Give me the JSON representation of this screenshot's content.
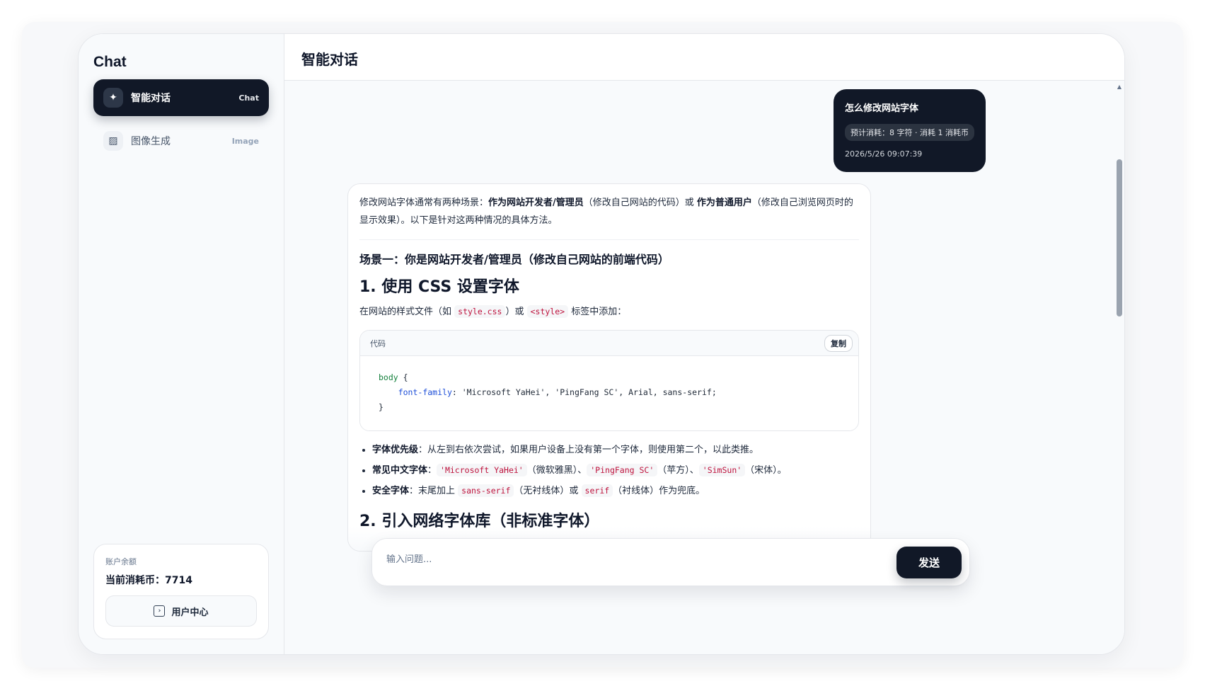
{
  "sidebar": {
    "title": "Chat",
    "items": [
      {
        "icon": "sparkle-icon",
        "label": "智能对话",
        "tag": "Chat"
      },
      {
        "icon": "image-icon",
        "label": "图像生成",
        "tag": "Image"
      }
    ],
    "balance": {
      "label": "账户余额",
      "value_text": "当前消耗币：7714",
      "user_center_label": "用户中心"
    }
  },
  "header": {
    "title": "智能对话"
  },
  "conversation": {
    "user_message": {
      "text": "怎么修改网站字体",
      "cost": "预计消耗：8 字符 · 消耗 1 消耗币",
      "time": "2026/5/26 09:07:39"
    },
    "assistant": {
      "intro_a": "修改网站字体通常有两种场景：",
      "intro_b1": "作为网站开发者/管理员",
      "intro_c": "（修改自己网站的代码）或 ",
      "intro_b2": "作为普通用户",
      "intro_d": "（修改自己浏览网页时的显示效果）。以下是针对这两种情况的具体方法。",
      "scene1_title": "场景一：你是网站开发者/管理员（修改自己网站的前端代码）",
      "h1": "1. 使用 CSS 设置字体",
      "para_a": "在网站的样式文件（如 ",
      "code1": "style.css",
      "para_b": "）或 ",
      "code2": "<style>",
      "para_c": " 标签中添加：",
      "code_label": "代码",
      "copy_label": "复制",
      "code_line1_sel": "body",
      "code_line1_rest": " {",
      "code_line2_prop": "font-family",
      "code_line2_rest": ": 'Microsoft YaHei', 'PingFang SC', Arial, sans-serif;",
      "code_line3": "}",
      "bullets": {
        "b1_key": "字体优先级",
        "b1_text": "：从左到右依次尝试，如果用户设备上没有第一个字体，则使用第二个，以此类推。",
        "b2_key": "常见中文字体",
        "b2_sep": "：",
        "b2_c1": "'Microsoft YaHei'",
        "b2_t1": "（微软雅黑）、",
        "b2_c2": "'PingFang SC'",
        "b2_t2": "（苹方）、",
        "b2_c3": "'SimSun'",
        "b2_t3": "（宋体）。",
        "b3_key": "安全字体",
        "b3_t1": "：末尾加上 ",
        "b3_c1": "sans-serif",
        "b3_t2": "（无衬线体）或 ",
        "b3_c2": "serif",
        "b3_t3": "（衬线体）作为兜底。"
      },
      "h2": "2. 引入网络字体库（非标准字体）"
    }
  },
  "composer": {
    "placeholder": "输入问题...",
    "send_label": "发送"
  }
}
